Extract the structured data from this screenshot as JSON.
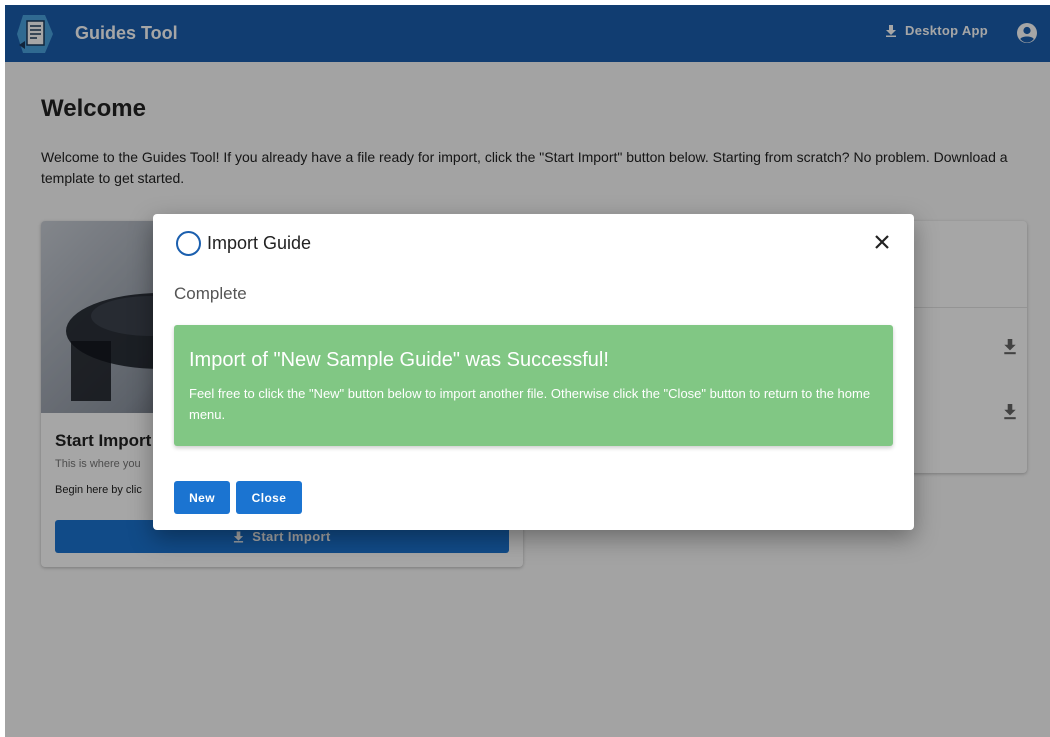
{
  "header": {
    "app_title": "Guides Tool",
    "desktop_app_label": "Desktop App"
  },
  "welcome": {
    "title": "Welcome",
    "text": "Welcome to the Guides Tool! If you already have a file ready for import, click the \"Start Import\" button below. Starting from scratch? No problem. Download a template to get started."
  },
  "import_card": {
    "title": "Start Import",
    "subtitle": "This is where you",
    "description": "Begin here by clic",
    "button_label": "Start Import"
  },
  "modal": {
    "title": "Import Guide",
    "status": "Complete",
    "success_title": "Import of \"New Sample Guide\" was Successful!",
    "success_text": "Feel free to click the \"New\" button below to import another file. Otherwise click the \"Close\" button to return to the home menu.",
    "new_label": "New",
    "close_label": "Close"
  },
  "colors": {
    "header": "#1b5fae",
    "primary_button": "#1b74d1",
    "success": "#81c784"
  },
  "icons": {
    "logo": "guide-document-logo",
    "download": "download-icon",
    "account": "account-circle-icon",
    "close": "close-icon",
    "status": "circle-outline-icon"
  }
}
